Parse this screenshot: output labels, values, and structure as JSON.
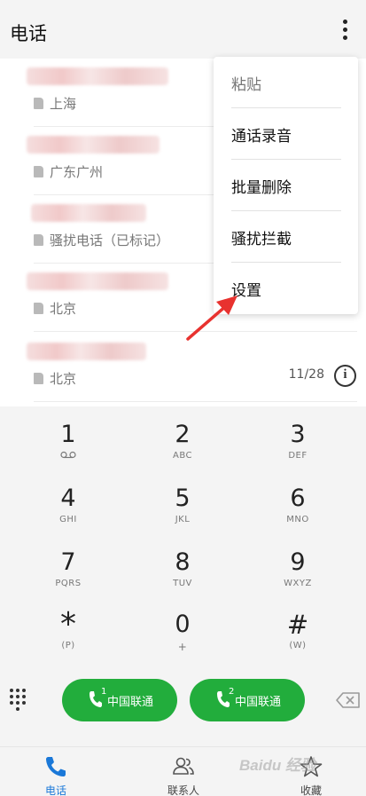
{
  "header": {
    "title": "电话"
  },
  "recent_calls": [
    {
      "location": "上海",
      "time": ""
    },
    {
      "location": "广东广州",
      "time": ""
    },
    {
      "location": "骚扰电话（已标记）",
      "time": ""
    },
    {
      "location": "北京",
      "time": ""
    },
    {
      "location": "北京",
      "time": "11/28"
    }
  ],
  "menu": {
    "items": [
      {
        "label": "粘贴"
      },
      {
        "label": "通话录音"
      },
      {
        "label": "批量删除"
      },
      {
        "label": "骚扰拦截"
      },
      {
        "label": "设置"
      }
    ]
  },
  "dialpad": {
    "keys": [
      {
        "digit": "1",
        "letters": ""
      },
      {
        "digit": "2",
        "letters": "ABC"
      },
      {
        "digit": "3",
        "letters": "DEF"
      },
      {
        "digit": "4",
        "letters": "GHI"
      },
      {
        "digit": "5",
        "letters": "JKL"
      },
      {
        "digit": "6",
        "letters": "MNO"
      },
      {
        "digit": "7",
        "letters": "PQRS"
      },
      {
        "digit": "8",
        "letters": "TUV"
      },
      {
        "digit": "9",
        "letters": "WXYZ"
      },
      {
        "digit": "*",
        "letters": "(P)"
      },
      {
        "digit": "0",
        "letters": "+"
      },
      {
        "digit": "#",
        "letters": "(W)"
      }
    ]
  },
  "call_buttons": [
    {
      "sim": "1",
      "carrier": "中国联通"
    },
    {
      "sim": "2",
      "carrier": "中国联通"
    }
  ],
  "nav": {
    "items": [
      {
        "label": "电话",
        "icon": "phone-icon"
      },
      {
        "label": "联系人",
        "icon": "contacts-icon"
      },
      {
        "label": "收藏",
        "icon": "star-icon"
      }
    ]
  },
  "watermark": "Baidu 经验",
  "colors": {
    "accent_green": "#22ad3c",
    "accent_blue": "#1a78d8",
    "arrow_red": "#e8322f"
  }
}
